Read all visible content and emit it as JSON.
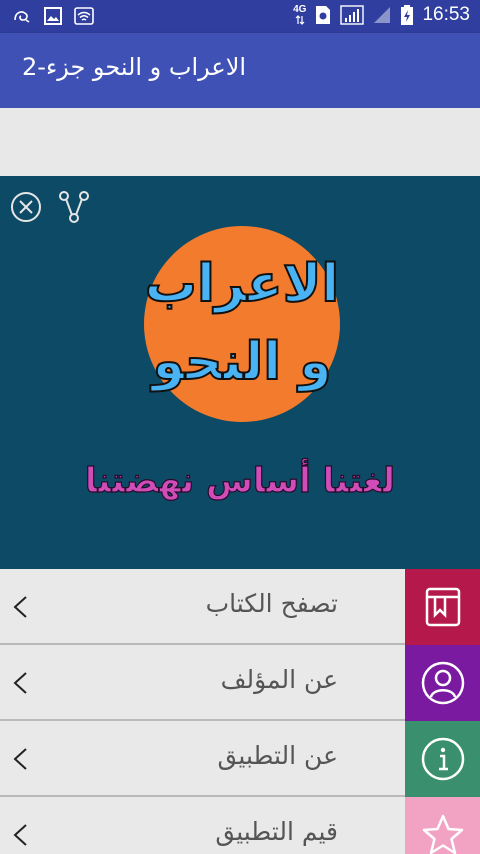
{
  "status_bar": {
    "network_label": "4G",
    "time": "16:53"
  },
  "app_bar": {
    "title": "الاعراب و النحو جزء-2"
  },
  "banner": {
    "logo_line1": "الاعراب",
    "logo_line2": "و النحو",
    "slogan": "لغتنا أساس نهضتنا",
    "colors": {
      "background": "#0d4a66",
      "circle": "#f37b2d",
      "logo_text": "#4ab3f4",
      "slogan_text": "#d04db8"
    }
  },
  "menu": {
    "items": [
      {
        "label": "تصفح الكتاب",
        "icon": "book-icon",
        "color": "#b5184a"
      },
      {
        "label": "عن المؤلف",
        "icon": "person-icon",
        "color": "#7a1aa0"
      },
      {
        "label": "عن التطبيق",
        "icon": "info-icon",
        "color": "#3a8f6e"
      },
      {
        "label": "قيم التطبيق",
        "icon": "star-icon",
        "color": "#f2a3c4"
      }
    ]
  }
}
